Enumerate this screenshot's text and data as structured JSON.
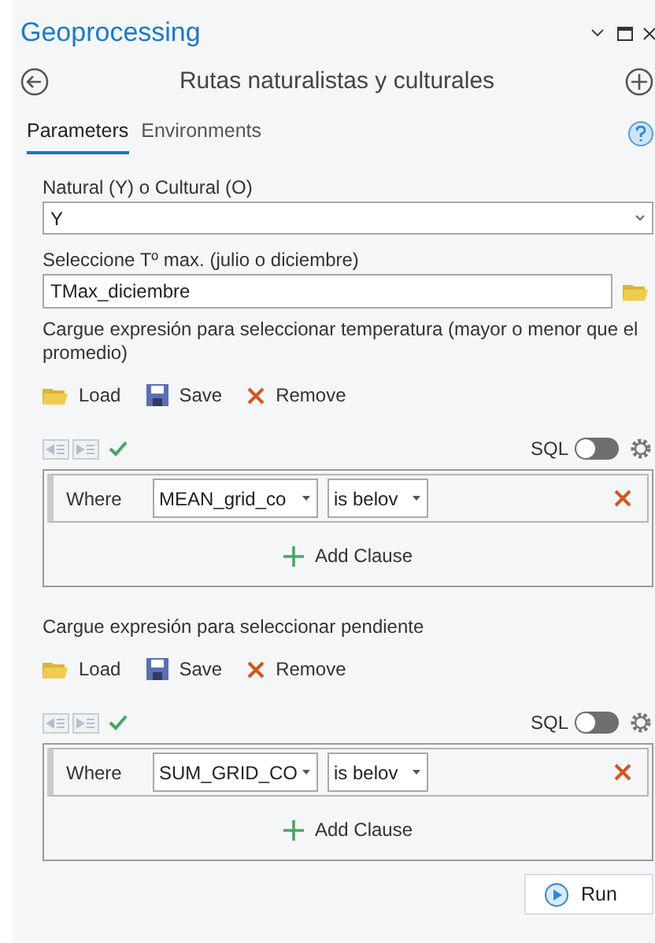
{
  "window": {
    "title": "Geoprocessing"
  },
  "tool": {
    "title": "Rutas naturalistas y culturales"
  },
  "tabs": [
    {
      "label": "Parameters",
      "selected": true
    },
    {
      "label": "Environments",
      "selected": false
    }
  ],
  "parameters": [
    {
      "kind": "select",
      "label": "Natural (Y) o Cultural (O)",
      "value": "Y"
    },
    {
      "kind": "file",
      "label": "Seleccione Tº max. (julio o diciembre)",
      "value": "TMax_diciembre"
    },
    {
      "kind": "expression",
      "label": "Cargue expresión para seleccionar temperatura (mayor o  menor que el promedio)",
      "actions": [
        "Load",
        "Save",
        "Remove"
      ],
      "sql_label": "SQL",
      "sql_on": false,
      "clause": {
        "where": "Where",
        "field": "MEAN_grid_co",
        "operator": "is belov"
      },
      "add_clause": "Add Clause"
    },
    {
      "kind": "expression",
      "label": "Cargue expresión para seleccionar pendiente",
      "actions": [
        "Load",
        "Save",
        "Remove"
      ],
      "sql_label": "SQL",
      "sql_on": false,
      "clause": {
        "where": "Where",
        "field": "SUM_GRID_CO",
        "operator": "is belov"
      },
      "add_clause": "Add Clause"
    }
  ],
  "run_button": {
    "label": "Run"
  }
}
